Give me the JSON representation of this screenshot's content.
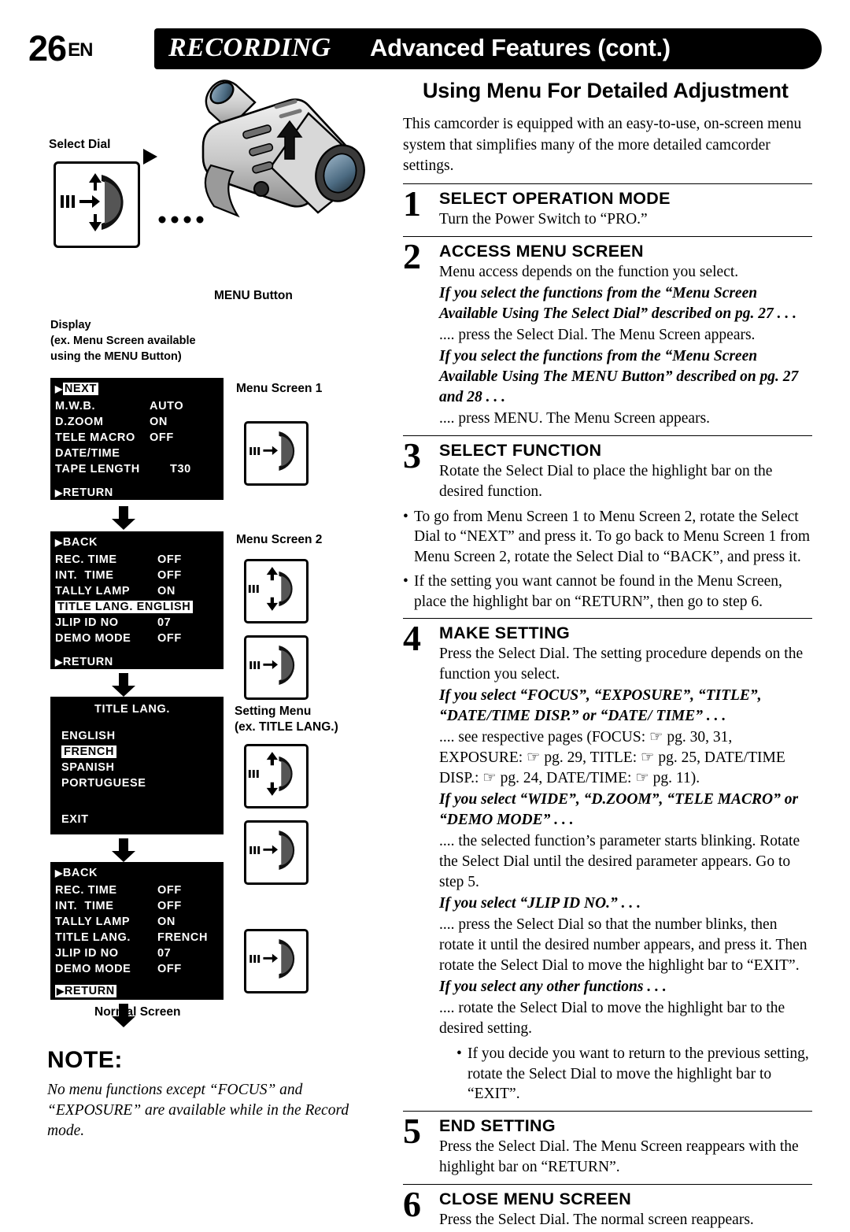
{
  "header": {
    "page_number": "26",
    "page_lang": "EN",
    "title_italic": "RECORDING",
    "title_rest": "Advanced Features (cont.)"
  },
  "left": {
    "select_dial_label": "Select Dial",
    "menu_button_label": "MENU Button",
    "display_label_line1": "Display",
    "display_label_line2": "(ex. Menu Screen available",
    "display_label_line3": "using the MENU Button)",
    "menu_screen_1_label": "Menu Screen 1",
    "menu_screen_2_label": "Menu Screen 2",
    "setting_menu_label_line1": "Setting Menu",
    "setting_menu_label_line2": "(ex. TITLE LANG.)",
    "normal_screen_label": "Normal Screen",
    "menu_screen_1": {
      "top_item": "NEXT",
      "rows": [
        {
          "name": "M.W.B.",
          "value": "AUTO"
        },
        {
          "name": "D.ZOOM",
          "value": "ON"
        },
        {
          "name": "TELE MACRO",
          "value": "OFF"
        },
        {
          "name": "DATE/TIME",
          "value": ""
        },
        {
          "name": "TAPE LENGTH",
          "value": "T30"
        }
      ],
      "bottom_item": "RETURN"
    },
    "menu_screen_2": {
      "top_item": "BACK",
      "rows": [
        {
          "name": "REC. TIME",
          "value": "OFF",
          "highlight": false
        },
        {
          "name": "INT.  TIME",
          "value": "OFF",
          "highlight": false
        },
        {
          "name": "TALLY LAMP",
          "value": "ON",
          "highlight": false
        },
        {
          "name": "TITLE LANG.",
          "value": "ENGLISH",
          "highlight": true
        },
        {
          "name": "JLIP ID NO",
          "value": "07",
          "highlight": false
        },
        {
          "name": "DEMO MODE",
          "value": "OFF",
          "highlight": false
        }
      ],
      "bottom_item": "RETURN"
    },
    "setting_menu": {
      "title": "TITLE LANG.",
      "options": [
        {
          "label": "ENGLISH",
          "highlight": false
        },
        {
          "label": "FRENCH",
          "highlight": true
        },
        {
          "label": "SPANISH",
          "highlight": false
        },
        {
          "label": "PORTUGUESE",
          "highlight": false
        }
      ],
      "exit": "EXIT"
    },
    "menu_screen_3": {
      "top_item": "BACK",
      "rows": [
        {
          "name": "REC. TIME",
          "value": "OFF",
          "highlight": false
        },
        {
          "name": "INT.  TIME",
          "value": "OFF",
          "highlight": false
        },
        {
          "name": "TALLY LAMP",
          "value": "ON",
          "highlight": false
        },
        {
          "name": "TITLE LANG.",
          "value": "FRENCH",
          "highlight": false
        },
        {
          "name": "JLIP ID NO",
          "value": "07",
          "highlight": false
        },
        {
          "name": "DEMO MODE",
          "value": "OFF",
          "highlight": false
        }
      ],
      "bottom_item": "RETURN",
      "bottom_highlight": true
    },
    "note": {
      "title": "NOTE:",
      "body": "No menu functions except “FOCUS” and “EXPOSURE” are available while in the Record mode."
    }
  },
  "right": {
    "section_title": "Using Menu For Detailed Adjustment",
    "intro": "This camcorder is equipped with an easy-to-use, on-screen menu system that simplifies many of the more detailed camcorder settings.",
    "steps": [
      {
        "num": "1",
        "title": "SELECT OPERATION MODE",
        "body": "Turn the Power Switch to “PRO.”"
      },
      {
        "num": "2",
        "title": "ACCESS MENU SCREEN",
        "body": "Menu access depends on the function you select.",
        "sub": [
          {
            "heading": "If you select the functions from the “Menu Screen Available Using The Select Dial” described on pg. 27 . . .",
            "text": ".... press the Select Dial. The Menu Screen appears."
          },
          {
            "heading": "If you select the functions from the “Menu Screen Available Using The MENU Button” described on pg. 27 and 28 . . .",
            "text": ".... press MENU. The Menu Screen appears.",
            "bold_word": "MENU"
          }
        ]
      },
      {
        "num": "3",
        "title": "SELECT FUNCTION",
        "body": "Rotate the Select Dial to place the highlight bar on the desired function.",
        "bullets": [
          "To go from Menu Screen 1 to Menu Screen 2, rotate the Select Dial to “NEXT” and press it. To go back to Menu Screen 1 from Menu Screen 2, rotate the Select Dial to “BACK”, and press it.",
          "If the setting you want cannot be found in the Menu Screen, place the highlight bar on “RETURN”, then go to step 6."
        ]
      },
      {
        "num": "4",
        "title": "MAKE SETTING",
        "body": "Press the Select Dial. The setting procedure depends on the function you select.",
        "sub": [
          {
            "heading": "If you select “FOCUS”, “EXPOSURE”, “TITLE”, “DATE/TIME DISP.” or “DATE/ TIME” . . .",
            "text": ".... see respective pages (FOCUS: ☞ pg. 30, 31, EXPOSURE: ☞ pg. 29, TITLE: ☞ pg. 25, DATE/TIME DISP.: ☞ pg. 24, DATE/TIME: ☞ pg. 11)."
          },
          {
            "heading": "If you select “WIDE”, “D.ZOOM”, “TELE MACRO” or “DEMO MODE” . . .",
            "text": ".... the selected function’s parameter starts blinking. Rotate the Select Dial until the desired parameter appears. Go to step 5."
          },
          {
            "heading": "If you select “JLIP ID NO.” . . .",
            "text": ".... press the Select Dial so that the number blinks, then rotate it until the desired number appears, and press it. Then rotate the Select Dial to move the highlight bar to “EXIT”."
          },
          {
            "heading": "If you select any other functions . . .",
            "text": ".... rotate the Select Dial to move the highlight bar to the desired setting."
          }
        ],
        "tail_bullet": "If you decide you want to return to the previous setting, rotate the Select Dial to move the highlight bar to “EXIT”."
      },
      {
        "num": "5",
        "title": "END SETTING",
        "body": "Press the Select Dial. The Menu Screen reappears with the highlight bar on “RETURN”."
      },
      {
        "num": "6",
        "title": "CLOSE MENU SCREEN",
        "body": "Press the Select Dial. The normal screen reappears."
      }
    ]
  }
}
